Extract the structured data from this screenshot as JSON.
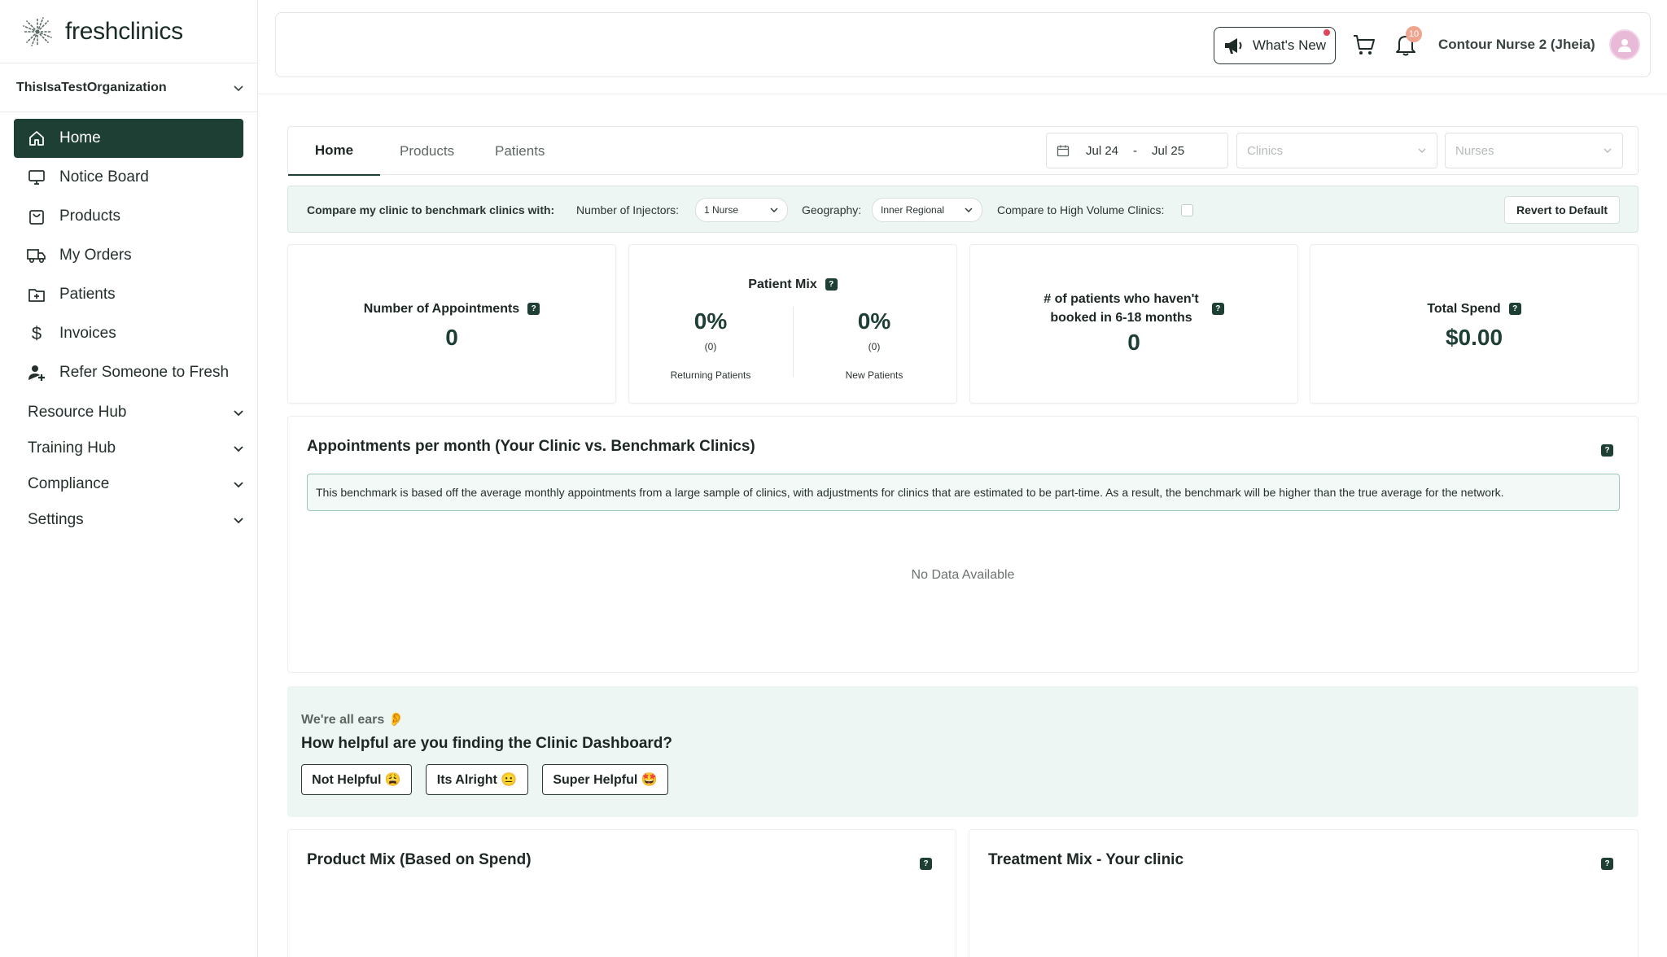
{
  "brand": {
    "name": "freshclinics"
  },
  "sidebar": {
    "org": "ThisIsaTestOrganization",
    "items": [
      {
        "label": "Home",
        "icon": "home-icon",
        "active": true
      },
      {
        "label": "Notice Board",
        "icon": "monitor-icon"
      },
      {
        "label": "Products",
        "icon": "bag-icon"
      },
      {
        "label": "My Orders",
        "icon": "truck-icon"
      },
      {
        "label": "Patients",
        "icon": "folder-plus-icon"
      },
      {
        "label": "Invoices",
        "icon": "dollar-icon"
      },
      {
        "label": "Refer Someone to Fresh",
        "icon": "user-plus-icon"
      }
    ],
    "groups": [
      {
        "label": "Resource Hub"
      },
      {
        "label": "Training Hub"
      },
      {
        "label": "Compliance"
      },
      {
        "label": "Settings"
      }
    ]
  },
  "topbar": {
    "whats_new": "What's New",
    "notification_count": "10",
    "user_name": "Contour Nurse 2 (Jheia)"
  },
  "tabs": [
    {
      "label": "Home",
      "active": true
    },
    {
      "label": "Products"
    },
    {
      "label": "Patients"
    }
  ],
  "filters": {
    "date_from": "Jul 24",
    "date_sep": "-",
    "date_to": "Jul 25",
    "clinics_placeholder": "Clinics",
    "nurses_placeholder": "Nurses"
  },
  "benchmark": {
    "intro": "Compare my clinic to benchmark clinics with:",
    "injectors_label": "Number of Injectors:",
    "injectors_value": "1 Nurse",
    "geography_label": "Geography:",
    "geography_value": "Inner Regional",
    "high_volume_label": "Compare to High Volume Clinics:",
    "revert": "Revert to Default"
  },
  "stats": {
    "appointments_title": "Number of Appointments",
    "appointments_value": "0",
    "patient_mix_title": "Patient Mix",
    "returning_pct": "0%",
    "returning_count": "(0)",
    "returning_label": "Returning Patients",
    "new_pct": "0%",
    "new_count": "(0)",
    "new_label": "New Patients",
    "not_booked_title_1": "# of patients who haven't",
    "not_booked_title_2": "booked in 6-18 months",
    "not_booked_value": "0",
    "spend_title": "Total Spend",
    "spend_value": "$0.00"
  },
  "appointments_chart": {
    "title": "Appointments per month (Your Clinic vs. Benchmark Clinics)",
    "info": "This benchmark is based off the average monthly appointments from a large sample of clinics, with adjustments for clinics that are estimated to be part-time. As a result, the benchmark will be higher than the true average for the network.",
    "empty": "No Data Available"
  },
  "feedback": {
    "intro": "We're all ears 👂",
    "question": "How helpful are you finding the Clinic Dashboard?",
    "options": [
      "Not Helpful 😩",
      "Its Alright 😐",
      "Super Helpful 🤩"
    ]
  },
  "bottom": {
    "product_mix": "Product Mix (Based on Spend)",
    "treatment_mix": "Treatment Mix - Your clinic"
  },
  "help_glyph": "?",
  "colors": {
    "primary": "#1e3f33",
    "accent_bg": "#edf6f2"
  }
}
